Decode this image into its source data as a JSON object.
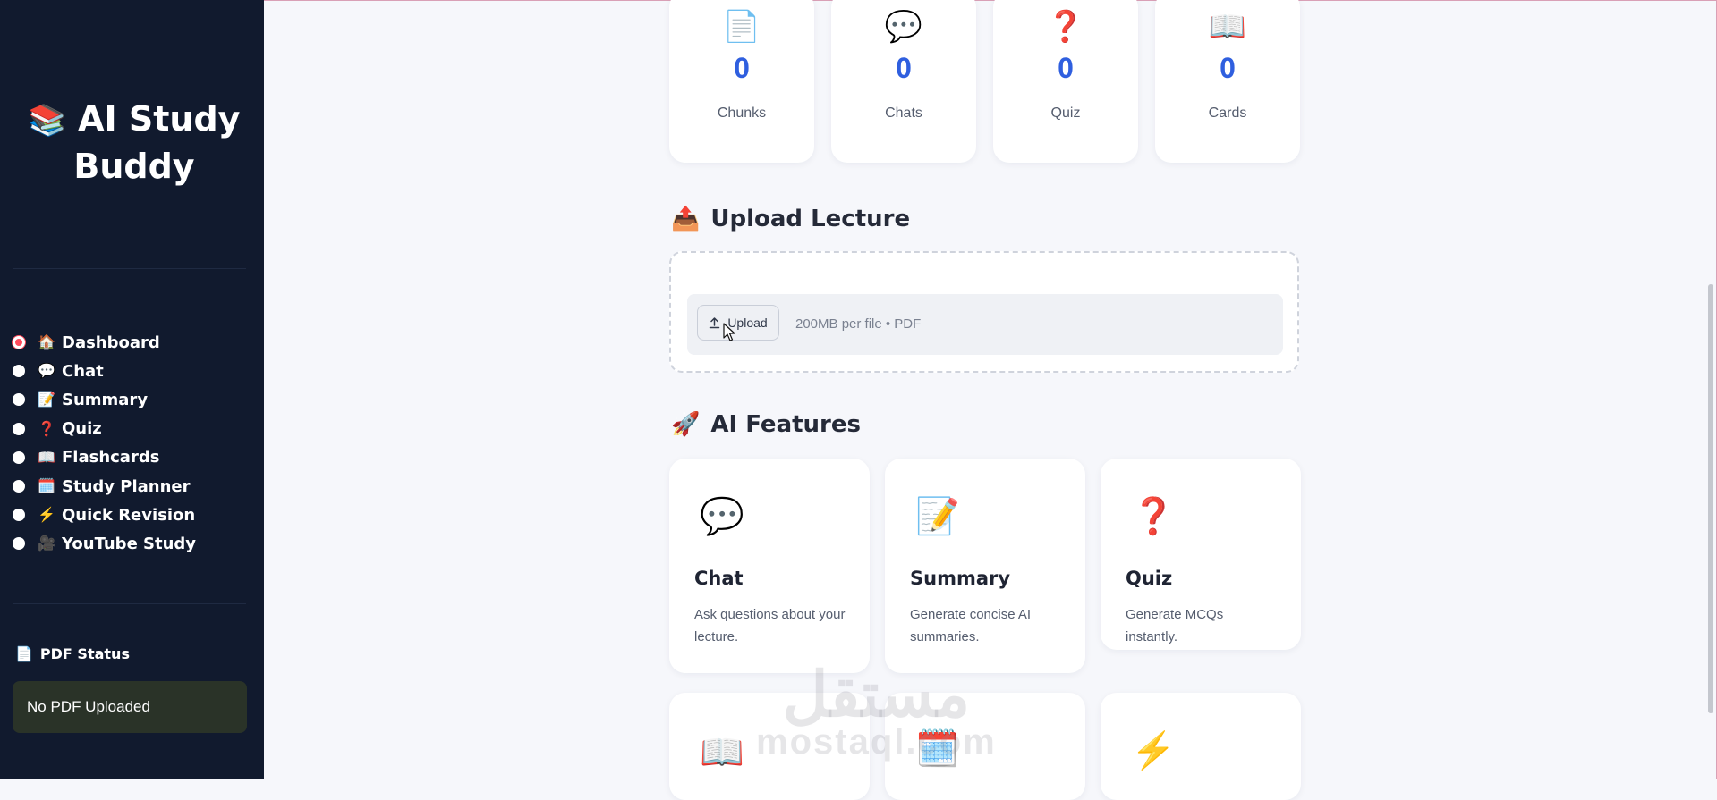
{
  "app": {
    "brand_emoji": "📚",
    "brand_title": "AI Study Buddy"
  },
  "sidebar": {
    "nav": [
      {
        "icon": "🏠",
        "label": "Dashboard",
        "selected": true
      },
      {
        "icon": "💬",
        "label": "Chat",
        "selected": false
      },
      {
        "icon": "📝",
        "label": "Summary",
        "selected": false
      },
      {
        "icon": "❓",
        "label": "Quiz",
        "selected": false
      },
      {
        "icon": "📖",
        "label": "Flashcards",
        "selected": false
      },
      {
        "icon": "🗓️",
        "label": "Study Planner",
        "selected": false
      },
      {
        "icon": "⚡",
        "label": "Quick Revision",
        "selected": false
      },
      {
        "icon": "🎥",
        "label": "YouTube Study",
        "selected": false
      }
    ],
    "pdf_status_icon": "📄",
    "pdf_status_title": "PDF Status",
    "pdf_status_value": "No PDF Uploaded"
  },
  "stats": [
    {
      "icon": "📄",
      "value": "0",
      "label": "Chunks"
    },
    {
      "icon": "💬",
      "value": "0",
      "label": "Chats"
    },
    {
      "icon": "❓",
      "value": "0",
      "label": "Quiz"
    },
    {
      "icon": "📖",
      "value": "0",
      "label": "Cards"
    }
  ],
  "upload": {
    "section_icon": "📤",
    "section_title": "Upload Lecture",
    "button_label": "Upload",
    "hint": "200MB per file • PDF"
  },
  "features": {
    "section_icon": "🚀",
    "section_title": "AI Features",
    "cards": [
      {
        "icon": "💬",
        "title": "Chat",
        "desc": "Ask questions about your lecture."
      },
      {
        "icon": "📝",
        "title": "Summary",
        "desc": "Generate concise AI summaries."
      },
      {
        "icon": "❓",
        "title": "Quiz",
        "desc": "Generate MCQs instantly."
      },
      {
        "icon": "📖",
        "title": "",
        "desc": ""
      },
      {
        "icon": "🗓️",
        "title": "",
        "desc": ""
      },
      {
        "icon": "⚡",
        "title": "",
        "desc": ""
      }
    ]
  },
  "watermark": {
    "arabic": "مستقل",
    "latin": "mostaql.com"
  },
  "colors": {
    "sidebar_bg": "#111a2e",
    "accent_value": "#2f5fdf",
    "radio_selected": "#ff4b5c",
    "page_bg": "#f6f7fb"
  }
}
